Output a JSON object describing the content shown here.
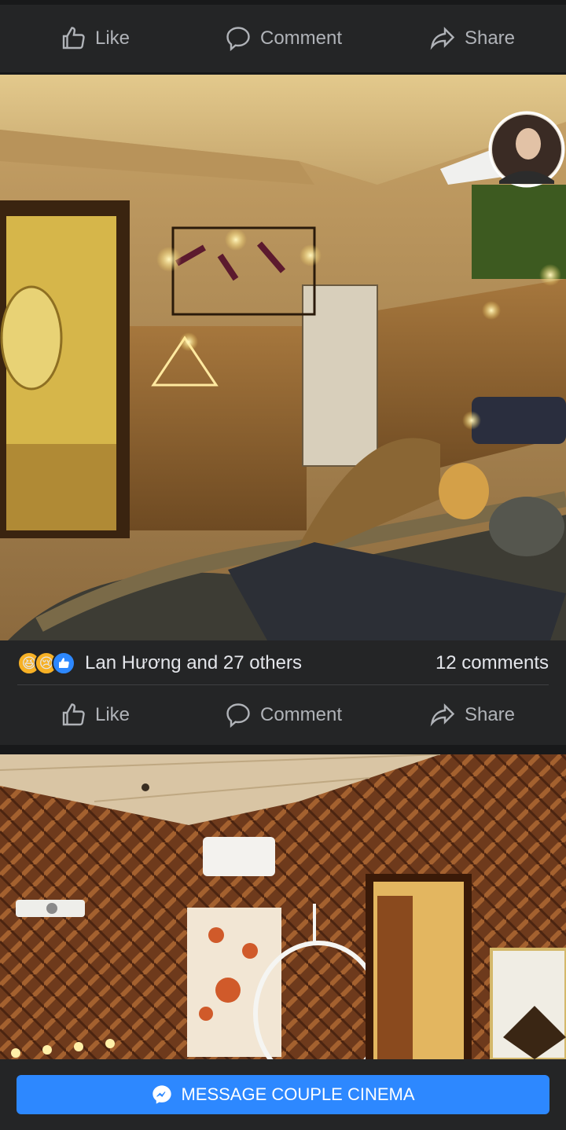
{
  "post1": {
    "actions": {
      "like": "Like",
      "comment": "Comment",
      "share": "Share"
    }
  },
  "post2": {
    "reactions": [
      "laugh",
      "sad",
      "like"
    ],
    "reactions_text": "Lan Hương and 27 others",
    "comments_count": "12 comments",
    "actions": {
      "like": "Like",
      "comment": "Comment",
      "share": "Share"
    }
  },
  "bottom": {
    "message_button": "MESSAGE COUPLE CINEMA"
  },
  "colors": {
    "background": "#18191a",
    "card": "#242526",
    "text_secondary": "#b0b3b8",
    "accent": "#2d88ff"
  }
}
